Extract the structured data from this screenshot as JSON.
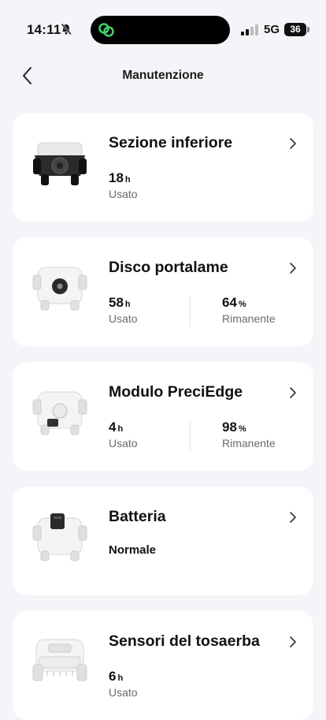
{
  "status_bar": {
    "time": "14:11",
    "network": "5G",
    "battery": "36"
  },
  "header": {
    "title": "Manutenzione"
  },
  "cards": [
    {
      "title": "Sezione inferiore",
      "left": {
        "value": "18",
        "unit": "h",
        "label": "Usato"
      }
    },
    {
      "title": "Disco portalame",
      "left": {
        "value": "58",
        "unit": "h",
        "label": "Usato"
      },
      "right": {
        "value": "64",
        "unit": "%",
        "label": "Rimanente"
      }
    },
    {
      "title": "Modulo PreciEdge",
      "left": {
        "value": "4",
        "unit": "h",
        "label": "Usato"
      },
      "right": {
        "value": "98",
        "unit": "%",
        "label": "Rimanente"
      }
    },
    {
      "title": "Batteria",
      "status": "Normale"
    },
    {
      "title": "Sensori del tosaerba",
      "left": {
        "value": "6",
        "unit": "h",
        "label": "Usato"
      }
    }
  ]
}
